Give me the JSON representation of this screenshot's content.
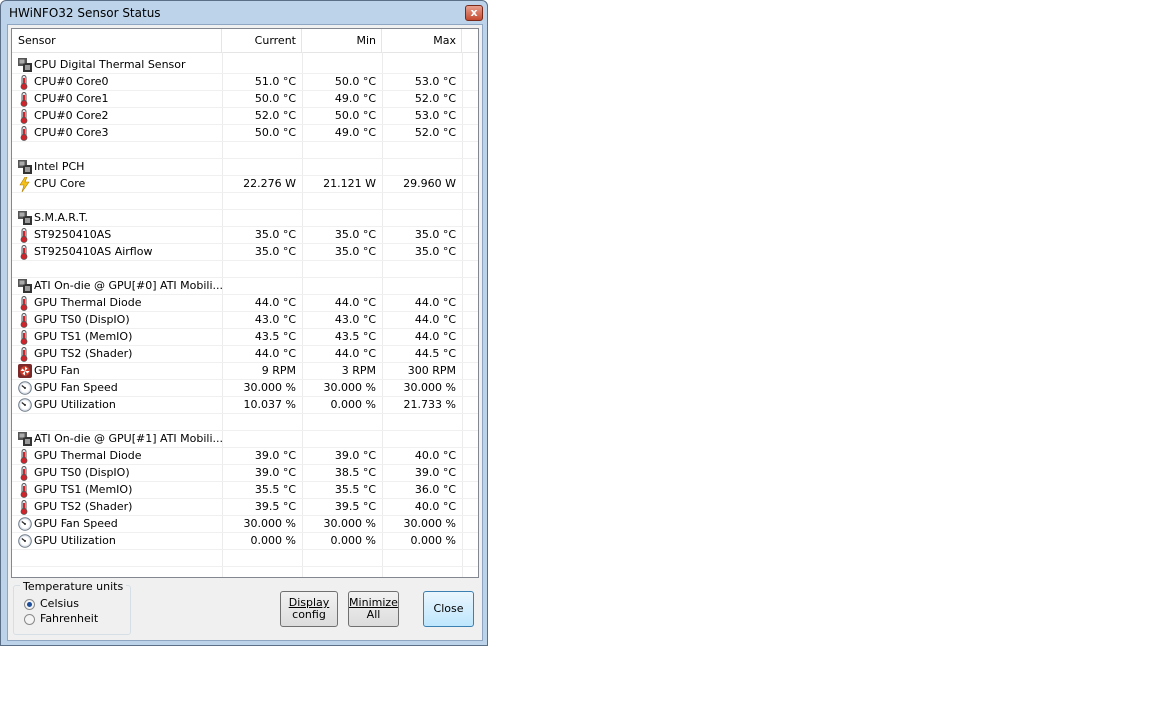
{
  "window": {
    "title": "HWiNFO32 Sensor Status",
    "close_glyph": "x"
  },
  "columns": {
    "sensor": "Sensor",
    "current": "Current",
    "min": "Min",
    "max": "Max"
  },
  "rows": [
    {
      "type": "group",
      "icon": "chip-icon",
      "label": "CPU Digital Thermal Sensor"
    },
    {
      "type": "item",
      "icon": "thermometer-icon",
      "label": "CPU#0 Core0",
      "current": "51.0 °C",
      "min": "50.0 °C",
      "max": "53.0 °C"
    },
    {
      "type": "item",
      "icon": "thermometer-icon",
      "label": "CPU#0 Core1",
      "current": "50.0 °C",
      "min": "49.0 °C",
      "max": "52.0 °C"
    },
    {
      "type": "item",
      "icon": "thermometer-icon",
      "label": "CPU#0 Core2",
      "current": "52.0 °C",
      "min": "50.0 °C",
      "max": "53.0 °C"
    },
    {
      "type": "item",
      "icon": "thermometer-icon",
      "label": "CPU#0 Core3",
      "current": "50.0 °C",
      "min": "49.0 °C",
      "max": "52.0 °C"
    },
    {
      "type": "blank"
    },
    {
      "type": "group",
      "icon": "chip-icon",
      "label": "Intel PCH"
    },
    {
      "type": "item",
      "icon": "lightning-icon",
      "label": "CPU Core",
      "current": "22.276 W",
      "min": "21.121 W",
      "max": "29.960 W"
    },
    {
      "type": "blank"
    },
    {
      "type": "group",
      "icon": "chip-icon",
      "label": "S.M.A.R.T."
    },
    {
      "type": "item",
      "icon": "thermometer-icon",
      "label": "ST9250410AS",
      "current": "35.0 °C",
      "min": "35.0 °C",
      "max": "35.0 °C"
    },
    {
      "type": "item",
      "icon": "thermometer-icon",
      "label": "ST9250410AS Airflow",
      "current": "35.0 °C",
      "min": "35.0 °C",
      "max": "35.0 °C"
    },
    {
      "type": "blank"
    },
    {
      "type": "group",
      "icon": "chip-icon",
      "label": "ATI On-die @ GPU[#0] ATI Mobili..."
    },
    {
      "type": "item",
      "icon": "thermometer-icon",
      "label": "GPU Thermal Diode",
      "current": "44.0 °C",
      "min": "44.0 °C",
      "max": "44.0 °C"
    },
    {
      "type": "item",
      "icon": "thermometer-icon",
      "label": "GPU TS0 (DispIO)",
      "current": "43.0 °C",
      "min": "43.0 °C",
      "max": "44.0 °C"
    },
    {
      "type": "item",
      "icon": "thermometer-icon",
      "label": "GPU TS1 (MemIO)",
      "current": "43.5 °C",
      "min": "43.5 °C",
      "max": "44.0 °C"
    },
    {
      "type": "item",
      "icon": "thermometer-icon",
      "label": "GPU TS2 (Shader)",
      "current": "44.0 °C",
      "min": "44.0 °C",
      "max": "44.5 °C"
    },
    {
      "type": "item",
      "icon": "fan-icon",
      "label": "GPU Fan",
      "current": "9 RPM",
      "min": "3 RPM",
      "max": "300 RPM"
    },
    {
      "type": "item",
      "icon": "gauge-icon",
      "label": "GPU Fan Speed",
      "current": "30.000 %",
      "min": "30.000 %",
      "max": "30.000 %"
    },
    {
      "type": "item",
      "icon": "gauge-icon",
      "label": "GPU Utilization",
      "current": "10.037 %",
      "min": "0.000 %",
      "max": "21.733 %"
    },
    {
      "type": "blank"
    },
    {
      "type": "group",
      "icon": "chip-icon",
      "label": "ATI On-die @ GPU[#1] ATI Mobili..."
    },
    {
      "type": "item",
      "icon": "thermometer-icon",
      "label": "GPU Thermal Diode",
      "current": "39.0 °C",
      "min": "39.0 °C",
      "max": "40.0 °C"
    },
    {
      "type": "item",
      "icon": "thermometer-icon",
      "label": "GPU TS0 (DispIO)",
      "current": "39.0 °C",
      "min": "38.5 °C",
      "max": "39.0 °C"
    },
    {
      "type": "item",
      "icon": "thermometer-icon",
      "label": "GPU TS1 (MemIO)",
      "current": "35.5 °C",
      "min": "35.5 °C",
      "max": "36.0 °C"
    },
    {
      "type": "item",
      "icon": "thermometer-icon",
      "label": "GPU TS2 (Shader)",
      "current": "39.5 °C",
      "min": "39.5 °C",
      "max": "40.0 °C"
    },
    {
      "type": "item",
      "icon": "gauge-icon",
      "label": "GPU Fan Speed",
      "current": "30.000 %",
      "min": "30.000 %",
      "max": "30.000 %"
    },
    {
      "type": "item",
      "icon": "gauge-icon",
      "label": "GPU Utilization",
      "current": "0.000 %",
      "min": "0.000 %",
      "max": "0.000 %"
    },
    {
      "type": "blank"
    }
  ],
  "temperature_units": {
    "title": "Temperature units",
    "options": [
      "Celsius",
      "Fahrenheit"
    ],
    "selected": "Celsius"
  },
  "buttons": {
    "display_config": {
      "line1": "Display",
      "line2": "config"
    },
    "minimize_all": {
      "line1": "Minimize",
      "line2": "All"
    },
    "close": "Close"
  }
}
